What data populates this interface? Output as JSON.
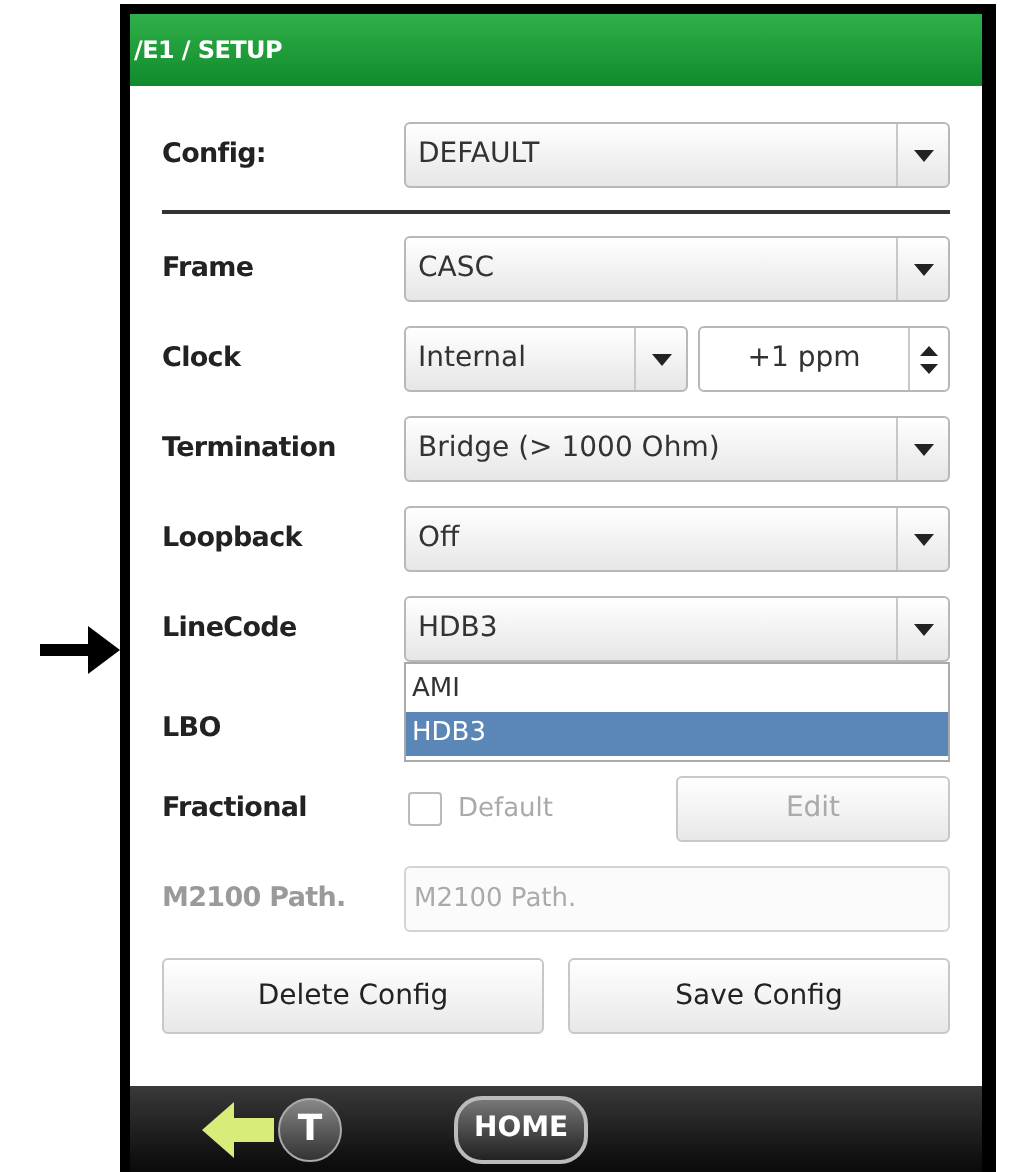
{
  "window": {
    "title": "/E1 / SETUP"
  },
  "config": {
    "label": "Config:",
    "value": "DEFAULT"
  },
  "rows": [
    {
      "kind": "select",
      "label": "Frame",
      "value": "CASC"
    },
    {
      "kind": "select_spin",
      "label": "Clock",
      "value": "Internal",
      "spin_value": "+1 ppm"
    },
    {
      "kind": "select",
      "label": "Termination",
      "value": "Bridge (> 1000 Ohm)"
    },
    {
      "kind": "select",
      "label": "Loopback",
      "value": "Off"
    },
    {
      "kind": "select",
      "label": "LineCode",
      "value": "HDB3",
      "pointer_arrow": true,
      "expanded": true,
      "options": [
        {
          "label": "AMI",
          "selected": false
        },
        {
          "label": "HDB3",
          "selected": true
        }
      ]
    },
    {
      "kind": "label",
      "label": "LBO"
    },
    {
      "kind": "checkbox_button",
      "label": "Fractional",
      "checkbox_label": "Default",
      "checked": false,
      "disabled": true,
      "button": "Edit"
    },
    {
      "kind": "field",
      "label": "M2100 Path.",
      "placeholder": "M2100 Path.",
      "disabled": true
    }
  ],
  "buttons": [
    "Delete Config",
    "Save Config"
  ],
  "nav": {
    "home": "HOME",
    "t": "T"
  }
}
